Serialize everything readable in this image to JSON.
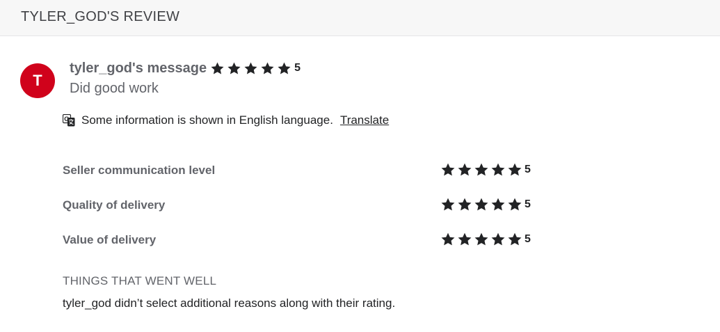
{
  "header": {
    "title": "TYLER_GOD'S REVIEW"
  },
  "review": {
    "avatar_initial": "T",
    "avatar_color": "#d0021b",
    "author_label": "tyler_god's message",
    "stars": 5,
    "rating": "5",
    "message": "Did good work"
  },
  "translation": {
    "icon": "translate-icon",
    "notice": "Some information is shown in English language.",
    "link_label": "Translate"
  },
  "ratings": [
    {
      "label": "Seller communication level",
      "stars": 5,
      "value": "5"
    },
    {
      "label": "Quality of delivery",
      "stars": 5,
      "value": "5"
    },
    {
      "label": "Value of delivery",
      "stars": 5,
      "value": "5"
    }
  ],
  "went_well": {
    "title": "THINGS THAT WENT WELL",
    "text": "tyler_god didn’t select additional reasons along with their rating."
  }
}
